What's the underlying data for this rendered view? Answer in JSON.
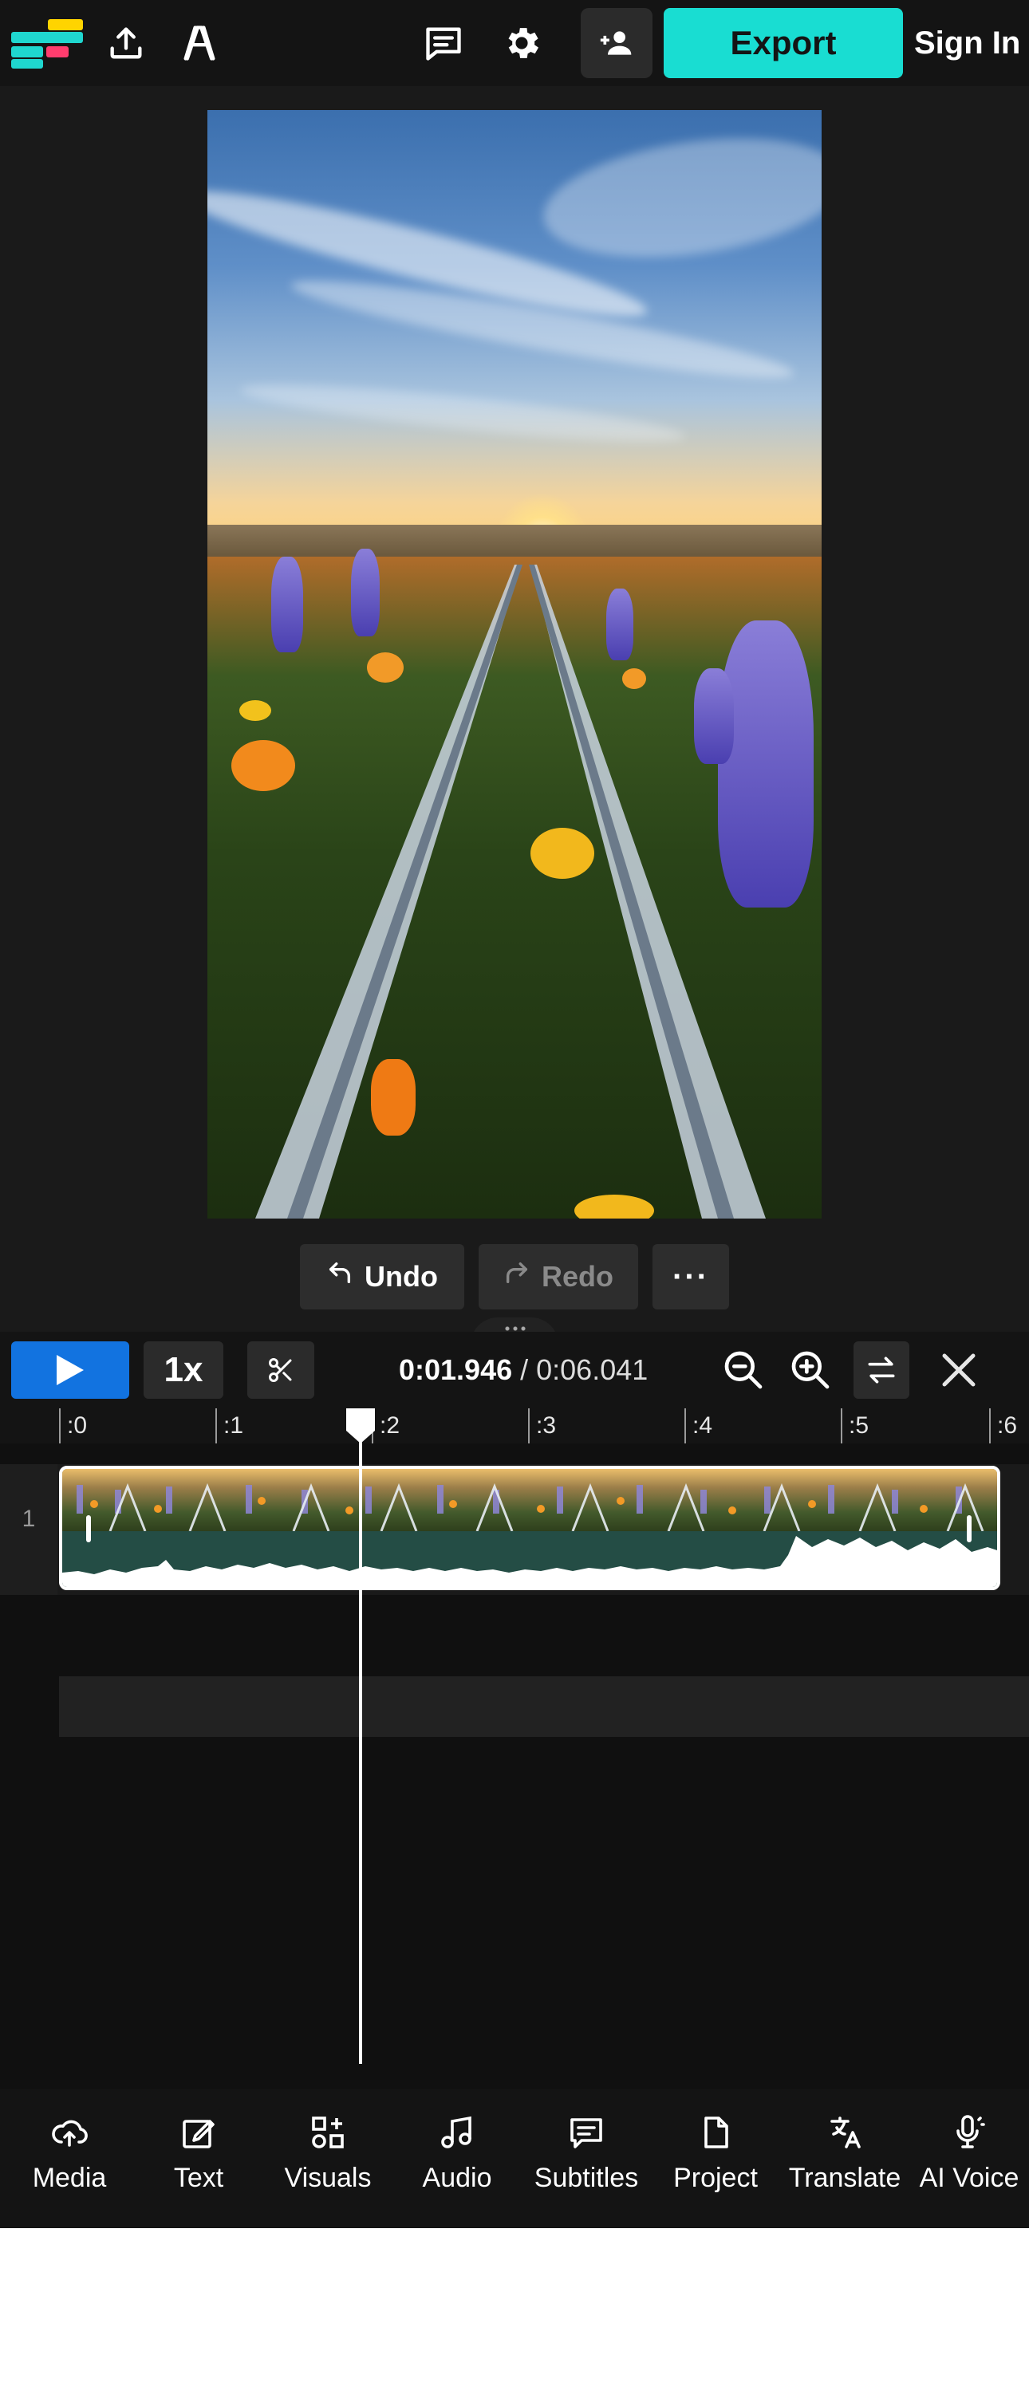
{
  "topbar": {
    "export_label": "Export",
    "signin_label": "Sign In",
    "icons": [
      "logo",
      "upload-icon",
      "font-icon",
      "comment-icon",
      "gear-icon",
      "add-person-icon"
    ],
    "logo_colors": [
      "#1fd7cf",
      "#ffd400",
      "#ff3d6e",
      "#1fd7cf"
    ]
  },
  "edit": {
    "undo_label": "Undo",
    "redo_label": "Redo",
    "more_label": "···"
  },
  "controls": {
    "speed_label": "1x",
    "current_time": "0:01.946",
    "separator": " / ",
    "total_time": "0:06.041"
  },
  "ruler": {
    "ticks": [
      ":0",
      ":1",
      ":2",
      ":3",
      ":4",
      ":5",
      ":6"
    ]
  },
  "tracks": {
    "track_number": "1"
  },
  "bottom_nav": {
    "items": [
      {
        "label": "Media",
        "icon": "upload-cloud-icon"
      },
      {
        "label": "Text",
        "icon": "pencil-icon"
      },
      {
        "label": "Visuals",
        "icon": "shapes-icon"
      },
      {
        "label": "Audio",
        "icon": "music-note-icon"
      },
      {
        "label": "Subtitles",
        "icon": "subtitles-icon"
      },
      {
        "label": "Project",
        "icon": "document-icon"
      },
      {
        "label": "Translate",
        "icon": "translate-icon"
      },
      {
        "label": "AI Voice",
        "icon": "microphone-icon"
      }
    ]
  },
  "colors": {
    "accent_export": "#19ddd2",
    "play_button": "#1273e0",
    "background": "#1a1a1a"
  }
}
